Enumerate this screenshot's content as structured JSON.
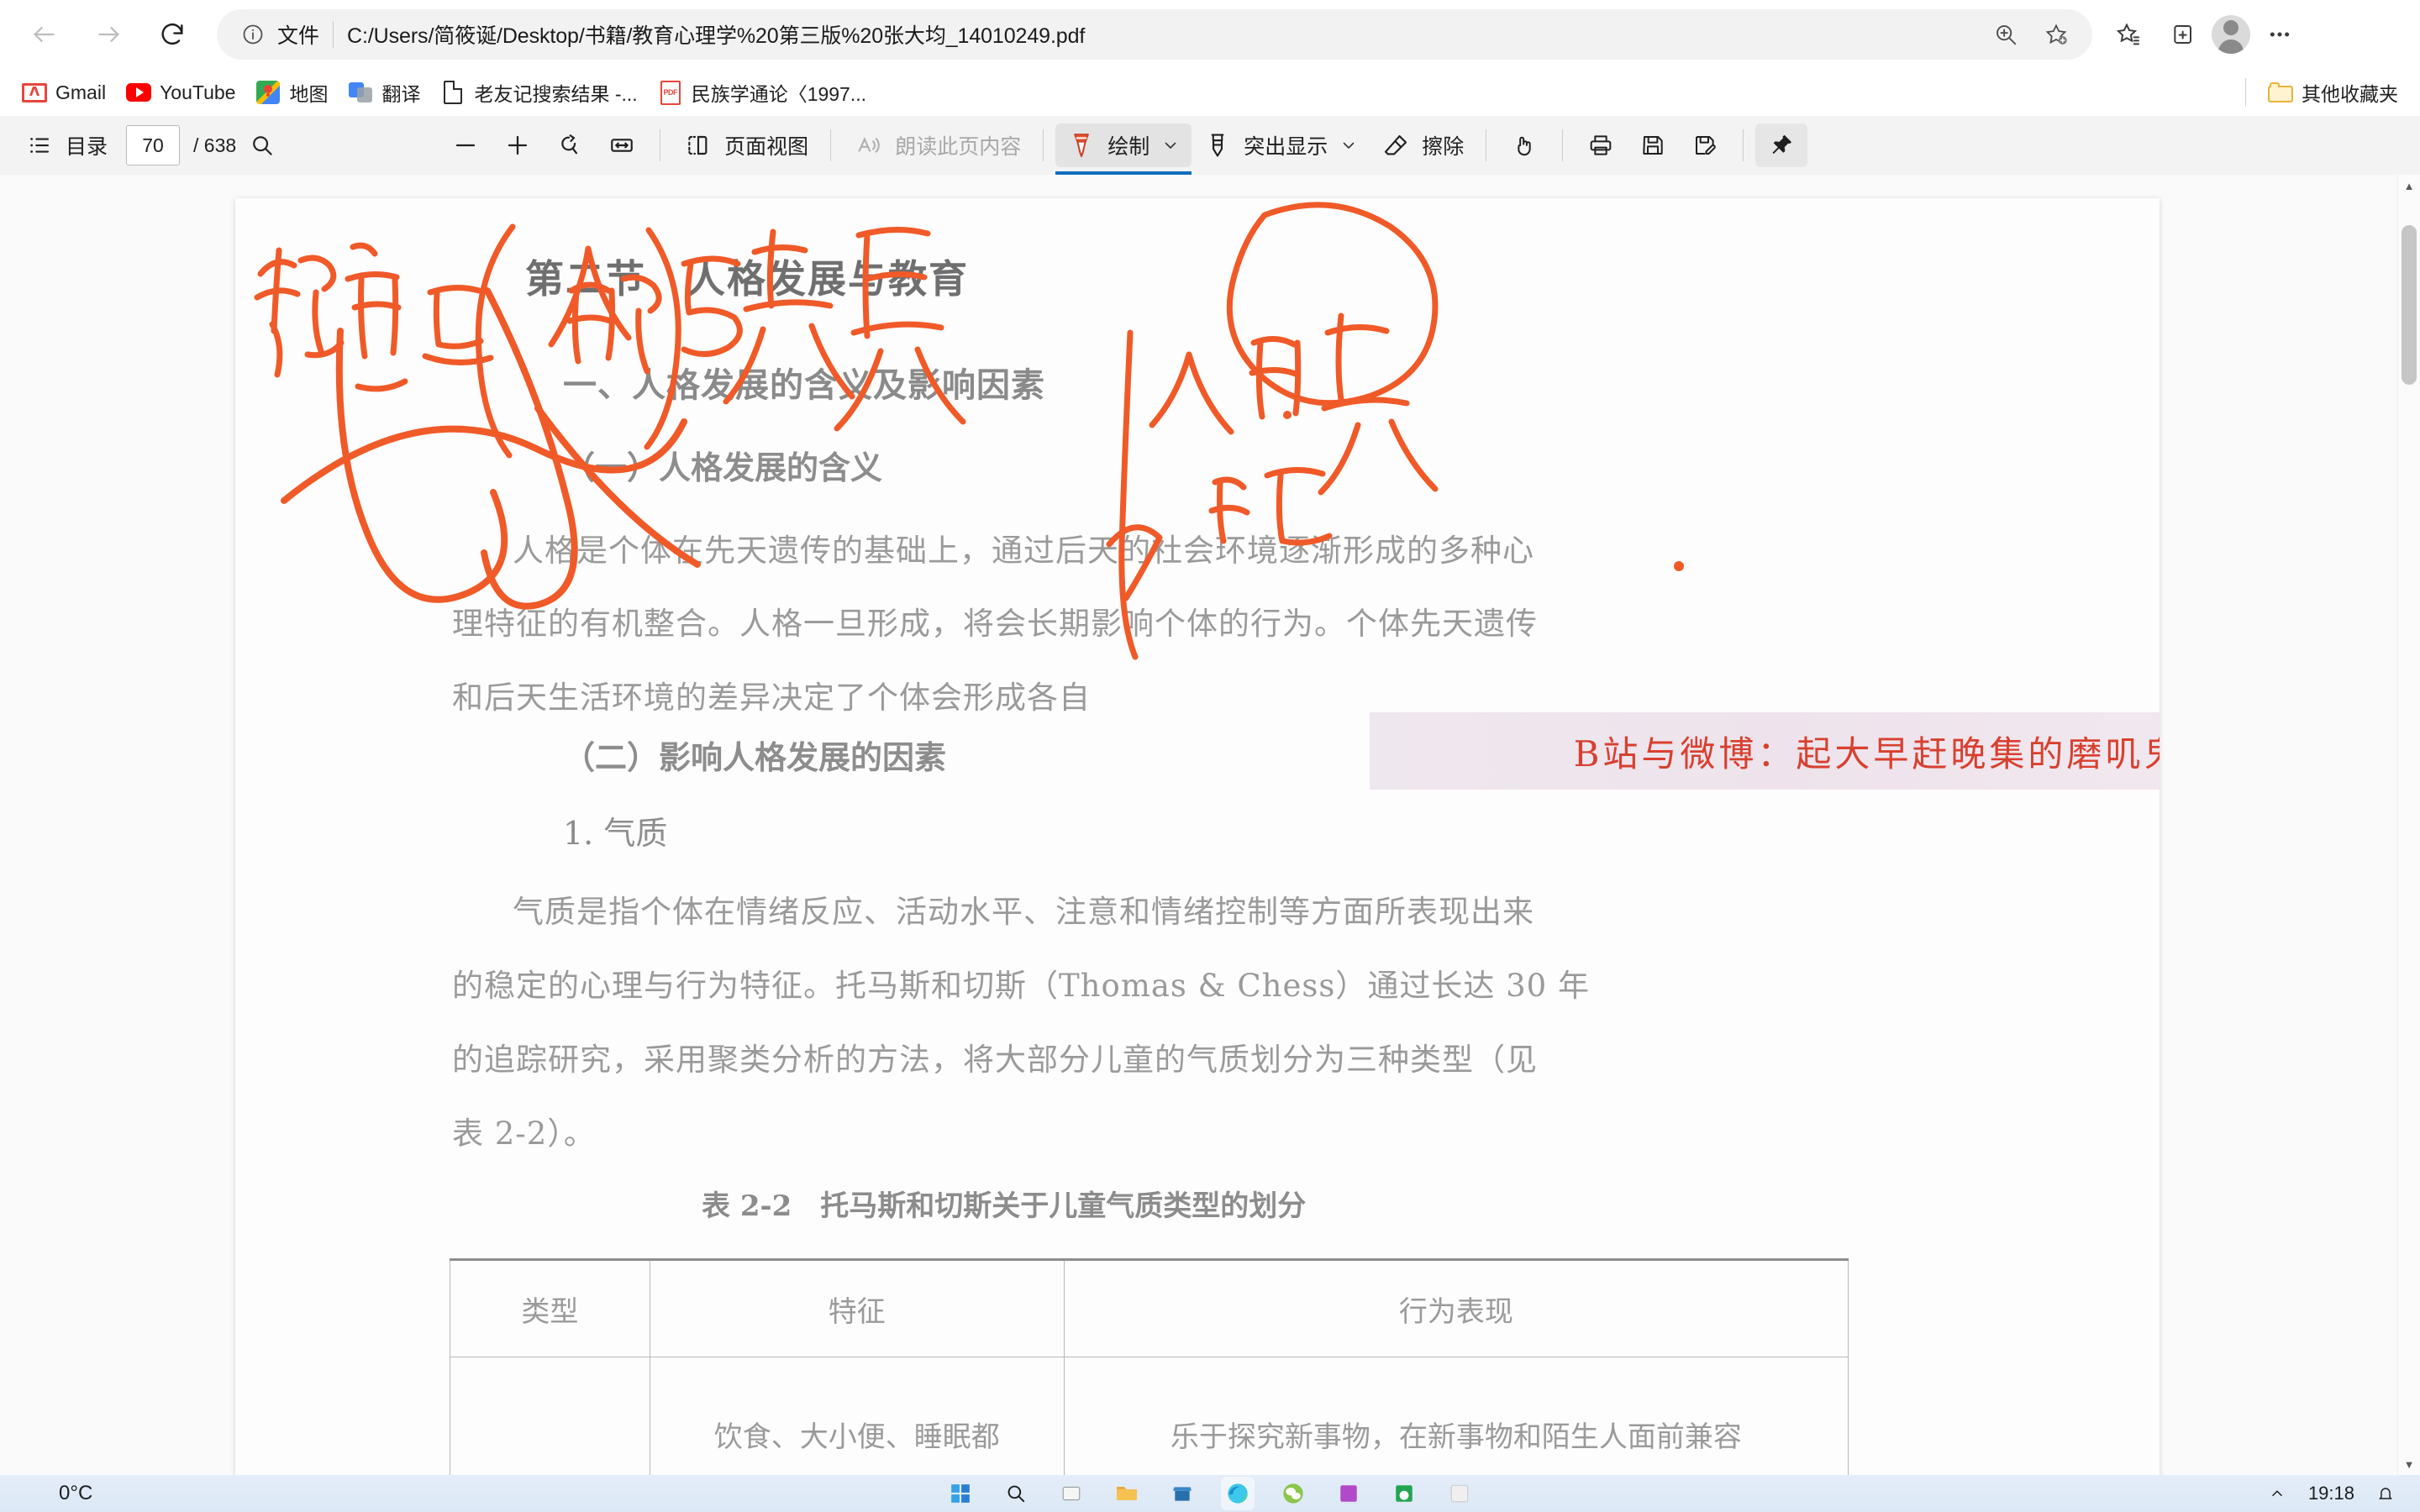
{
  "browser": {
    "nav": {
      "back_label": "Back",
      "back_icon": "arrow-left-icon",
      "forward_label": "Forward",
      "forward_icon": "arrow-right-icon",
      "refresh_label": "Refresh",
      "refresh_icon": "refresh-icon"
    },
    "omnibox": {
      "info_icon": "info-circle-icon",
      "scheme_label": "文件",
      "url": "C:/Users/简筱诞/Desktop/书籍/教育心理学%20第三版%20张大均_14010249.pdf",
      "zoom_icon": "zoom-in-icon",
      "add_favorite_icon": "star-add-icon"
    },
    "toolbar_right": [
      {
        "name": "favorites-icon",
        "label": "收藏夹"
      },
      {
        "name": "collections-icon",
        "label": "集锦"
      },
      {
        "name": "profile-avatar",
        "label": "个人资料"
      },
      {
        "name": "settings-more-icon",
        "label": "设置及其他"
      }
    ]
  },
  "bookmarks": {
    "items": [
      {
        "label": "Gmail",
        "icon": "gmail-icon"
      },
      {
        "label": "YouTube",
        "icon": "youtube-icon"
      },
      {
        "label": "地图",
        "icon": "google-maps-icon"
      },
      {
        "label": "翻译",
        "icon": "google-translate-icon"
      },
      {
        "label": "老友记搜索结果 -...",
        "icon": "page-icon"
      },
      {
        "label": "民族学通论〈1997...",
        "icon": "pdf-icon"
      }
    ],
    "other_folder": {
      "label": "其他收藏夹",
      "icon": "folder-icon"
    }
  },
  "pdf_toolbar": {
    "contents_label": "目录",
    "contents_icon": "list-icon",
    "page_current": "70",
    "page_total": "/ 638",
    "search_icon": "search-icon",
    "zoom_out_icon": "minus-icon",
    "zoom_in_icon": "plus-icon",
    "rotate_icon": "rotate-icon",
    "fit_width_icon": "fit-width-icon",
    "page_view_label": "页面视图",
    "page_view_icon": "page-view-icon",
    "read_aloud_label": "朗读此页内容",
    "read_aloud_icon": "read-aloud-icon",
    "draw_label": "绘制",
    "draw_icon": "pen-icon",
    "draw_caret_icon": "chevron-down-icon",
    "draw_active": true,
    "highlight_label": "突出显示",
    "highlight_icon": "highlighter-icon",
    "highlight_caret_icon": "chevron-down-icon",
    "erase_label": "擦除",
    "erase_icon": "eraser-icon",
    "hand_icon": "hand-icon",
    "print_icon": "print-icon",
    "save_icon": "save-icon",
    "save_as_icon": "save-as-icon",
    "pin_icon": "pin-icon",
    "collapse_icon": "chevron-up-icon"
  },
  "document": {
    "section_title": "第二节　人格发展与教育",
    "heading_1": "一、人格发展的含义及影响因素",
    "heading_2": "（一）人格发展的含义",
    "para_1_line_1": "人格是个体在先天遗传的基础上，通过后天的社会环境逐渐形成的多种心",
    "para_1_line_2": "理特征的有机整合。人格一旦形成，将会长期影响个体的行为。个体先天遗传",
    "para_1_line_3": "和后天生活环境的差异决定了个体会形成各自",
    "heading_3": "（二）影响人格发展的因素",
    "heading_4": "1. 气质",
    "para_2_line_1": "气质是指个体在情绪反应、活动水平、注意和情绪控制等方面所表现出来",
    "para_2_line_2": "的稳定的心理与行为特征。托马斯和切斯（Thomas & Chess）通过长达 30 年",
    "para_2_line_3": "的追踪研究，采用聚类分析的方法，将大部分儿童的气质划分为三种类型（见",
    "para_2_line_4": "表 2-2）。",
    "table_caption": "表 2-2　托马斯和切斯关于儿童气质类型的划分",
    "table_headers": [
      "类型",
      "特征",
      "行为表现"
    ],
    "table_rows": [
      [
        "",
        "饮食、大小便、睡眠都",
        "乐于探究新事物，在新事物和陌生人面前兼容"
      ]
    ]
  },
  "annotations": {
    "ink_color": "#F05A28",
    "notes": [
      "教育与人的发展",
      "人格",
      "认知"
    ]
  },
  "watermark": {
    "text": "B站与微博：起大早赶晚集的磨叽鬼",
    "color": "#D8402F",
    "background": "#EEE5EC"
  },
  "taskbar": {
    "weather_temp": "0°C",
    "clock_time": "19:18",
    "items": [
      {
        "name": "start-button",
        "label": "开始"
      },
      {
        "name": "search-taskbar",
        "label": "搜索"
      },
      {
        "name": "task-view",
        "label": "任务视图"
      },
      {
        "name": "file-explorer",
        "label": "文件资源管理器"
      },
      {
        "name": "store-icon",
        "label": "Microsoft Store"
      },
      {
        "name": "edge-icon",
        "label": "Microsoft Edge"
      },
      {
        "name": "wechat-icon",
        "label": "微信"
      },
      {
        "name": "onenote-icon",
        "label": "OneNote"
      },
      {
        "name": "wps-icon",
        "label": "WPS"
      }
    ]
  }
}
